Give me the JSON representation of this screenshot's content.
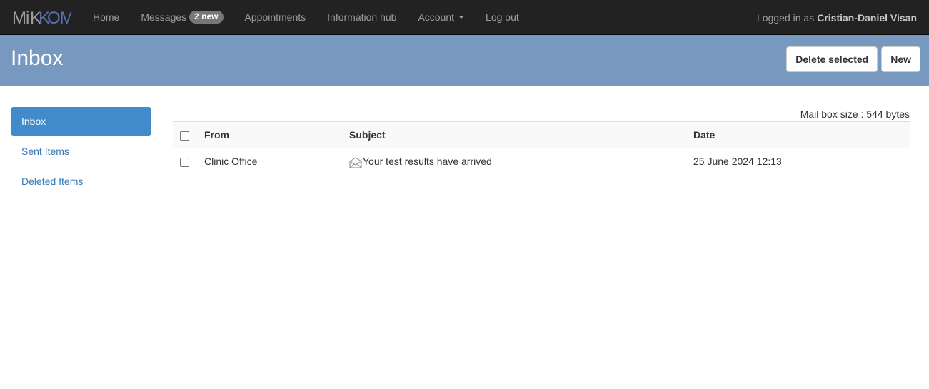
{
  "brand": {
    "name": "MiKKOM"
  },
  "nav": {
    "items": [
      {
        "label": "Home"
      },
      {
        "label": "Messages",
        "badge": "2 new"
      },
      {
        "label": "Appointments"
      },
      {
        "label": "Information hub"
      },
      {
        "label": "Account",
        "has_caret": true
      },
      {
        "label": "Log out"
      }
    ],
    "logged_in_prefix": "Logged in as",
    "user_name": "Cristian-Daniel Visan"
  },
  "header": {
    "title": "Inbox",
    "delete_label": "Delete selected",
    "new_label": "New"
  },
  "sidebar": {
    "items": [
      {
        "label": "Inbox",
        "active": true
      },
      {
        "label": "Sent Items",
        "active": false
      },
      {
        "label": "Deleted Items",
        "active": false
      }
    ]
  },
  "mailbox": {
    "size_text": "Mail box size : 544 bytes",
    "columns": {
      "from": "From",
      "subject": "Subject",
      "date": "Date"
    },
    "rows": [
      {
        "from": "Clinic Office",
        "subject": "Your test results have arrived",
        "date": "25 June 2024 12:13",
        "icon": "envelope-open-icon"
      }
    ]
  },
  "colors": {
    "navbar": "#222222",
    "header_band": "#7899bf",
    "active_item": "#428bca",
    "link": "#337ab7"
  }
}
